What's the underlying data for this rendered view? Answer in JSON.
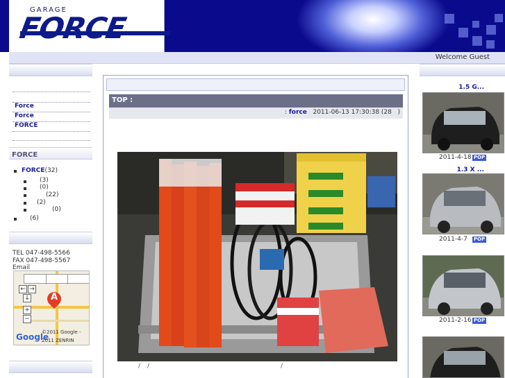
{
  "header": {
    "logo_small": "GARAGE",
    "logo_main": "FORCE",
    "welcome": "Welcome Guest"
  },
  "sidebar": {
    "links": [
      "Force",
      "Force",
      "FORCE"
    ],
    "category_heading": "FORCE",
    "categories": [
      {
        "label": "FORCE",
        "count": "(32)"
      },
      {
        "label": "",
        "count": "(3)"
      },
      {
        "label": "",
        "count": "(0)"
      },
      {
        "label": "",
        "count": "(22)"
      },
      {
        "label": "",
        "count": "(2)"
      },
      {
        "label": "",
        "count": "(0)"
      },
      {
        "label": "",
        "count": "(6)"
      }
    ],
    "tel": "TEL 047-498-5566",
    "fax": "FAX 047-498-5567",
    "email": "Email",
    "map": {
      "zoom_in": "+",
      "zoom_out": "−",
      "pan_left": "←",
      "pan_right": "→",
      "pan_down": "↓",
      "marker": "A",
      "google": "Google",
      "copyright": "©2011 Google -",
      "zenrin": "2011 ZENRIN"
    }
  },
  "entry": {
    "title": "TOP :",
    "author_prefix": ":",
    "author": "force",
    "datetime": "2011-06-13 17:30:38 (28",
    "meta_suffix": ")",
    "footer_slash1": "/",
    "footer_slash2": "/",
    "footer_slash3": "/"
  },
  "right_column": {
    "cars": [
      {
        "title": "1.5 G...",
        "date": "2011-4-18",
        "badge": "POP"
      },
      {
        "title": "1.3 X ...",
        "date": "2011-4-7",
        "badge": "POP"
      },
      {
        "title": "",
        "date": "2011-2-16",
        "badge": "POP"
      },
      {
        "title": "",
        "date": "",
        "badge": ""
      }
    ]
  },
  "colors": {
    "header_blue": "#0a0a8c",
    "link_blue": "#1a1a9a",
    "entry_bar": "#6b6f88"
  }
}
